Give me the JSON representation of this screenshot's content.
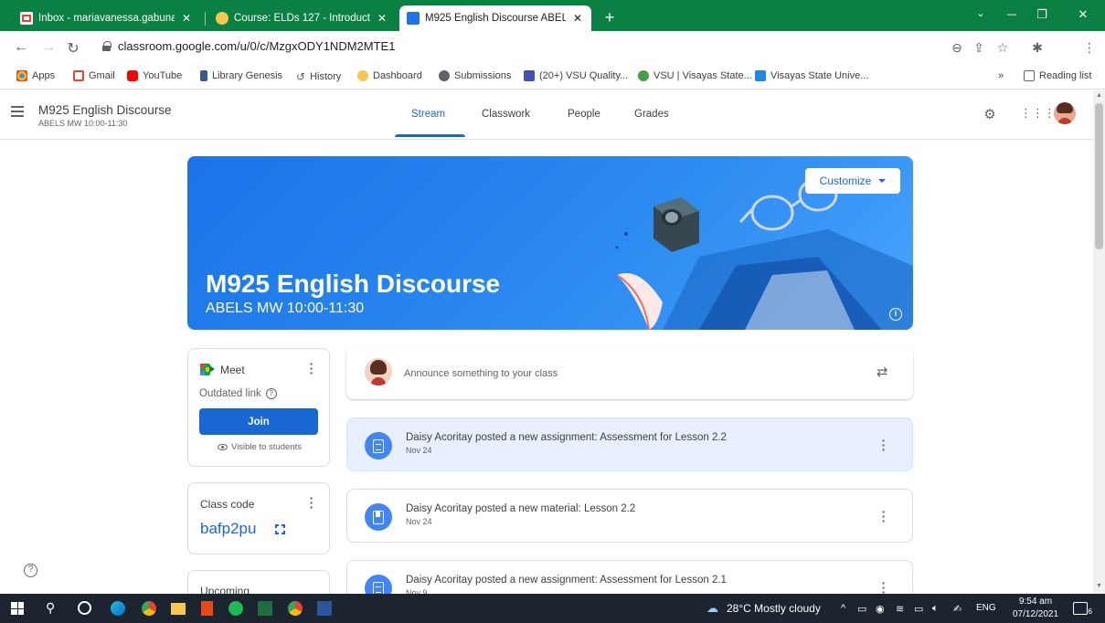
{
  "browser": {
    "tabs": [
      {
        "title": "Inbox - mariavanessa.gabunada@",
        "active": false
      },
      {
        "title": "Course: ELDs 127 - Introduction t",
        "active": false
      },
      {
        "title": "M925 English Discourse ABELS M",
        "active": true
      }
    ],
    "url": "classroom.google.com/u/0/c/MzgxODY1NDM2MTE1",
    "bookmarks": [
      "Apps",
      "Gmail",
      "YouTube",
      "Library Genesis",
      "History",
      "Dashboard",
      "Submissions",
      "(20+) VSU Quality...",
      "VSU | Visayas State...",
      "Visayas State Unive..."
    ],
    "reading_list": "Reading list",
    "more_bookmarks": "»"
  },
  "header": {
    "class_name": "M925 English Discourse",
    "class_section": "ABELS MW 10:00-11:30",
    "tabs": [
      "Stream",
      "Classwork",
      "People",
      "Grades"
    ],
    "active_tab": "Stream"
  },
  "banner": {
    "title": "M925 English Discourse",
    "subtitle": "ABELS MW 10:00-11:30",
    "customize_label": "Customize",
    "color": "#1a73e8"
  },
  "meet": {
    "label": "Meet",
    "status": "Outdated link",
    "join_label": "Join",
    "visibility": "Visible to students"
  },
  "class_code": {
    "label": "Class code",
    "value": "bafp2pu"
  },
  "upcoming": {
    "label": "Upcoming"
  },
  "stream": {
    "announce_placeholder": "Announce something to your class",
    "posts": [
      {
        "type": "assignment",
        "title": "Daisy Acoritay posted a new assignment: Assessment for Lesson 2.2",
        "date": "Nov 24",
        "highlight": true
      },
      {
        "type": "material",
        "title": "Daisy Acoritay posted a new material: Lesson 2.2",
        "date": "Nov 24",
        "highlight": false
      },
      {
        "type": "assignment",
        "title": "Daisy Acoritay posted a new assignment: Assessment for Lesson 2.1",
        "date": "Nov 9",
        "highlight": false
      }
    ]
  },
  "taskbar": {
    "weather": "28°C Mostly cloudy",
    "language": "ENG",
    "time": "9:54 am",
    "date": "07/12/2021",
    "notifications": "6"
  }
}
